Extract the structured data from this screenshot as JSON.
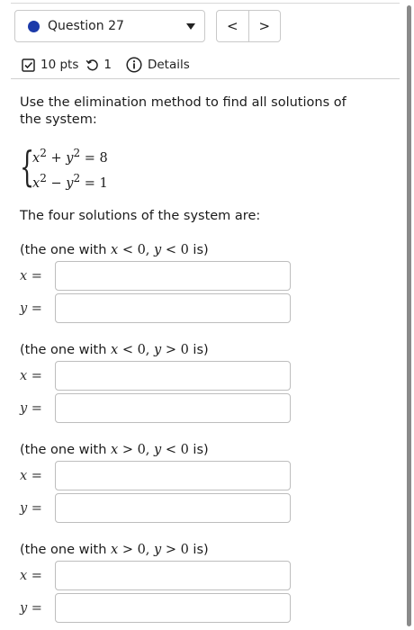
{
  "header": {
    "question_label": "Question 27",
    "nav_prev": "<",
    "nav_next": ">",
    "status_color": "#1c3aa9"
  },
  "meta": {
    "points": "10 pts",
    "attempts": "1",
    "details_label": "Details"
  },
  "question": {
    "prompt": "Use the elimination method to find all solutions of the system:",
    "equations": {
      "eq1": {
        "lhs_a": "x",
        "exp_a": "2",
        "op": " + ",
        "lhs_b": "y",
        "exp_b": "2",
        "rhs": " = 8"
      },
      "eq2": {
        "lhs_a": "x",
        "exp_a": "2",
        "op": " − ",
        "lhs_b": "y",
        "exp_b": "2",
        "rhs": " = 1"
      }
    },
    "four_solutions_text": "The four solutions of the system are:"
  },
  "cases": [
    {
      "label_prefix": "(the one with ",
      "x_var": "x",
      "x_cond": " < 0, ",
      "y_var": "y",
      "y_cond": " < 0",
      "label_suffix": " is)",
      "x_value": "",
      "y_value": ""
    },
    {
      "label_prefix": "(the one with ",
      "x_var": "x",
      "x_cond": " < 0, ",
      "y_var": "y",
      "y_cond": " > 0",
      "label_suffix": " is)",
      "x_value": "",
      "y_value": ""
    },
    {
      "label_prefix": "(the one with ",
      "x_var": "x",
      "x_cond": " > 0, ",
      "y_var": "y",
      "y_cond": " < 0",
      "label_suffix": " is)",
      "x_value": "",
      "y_value": ""
    },
    {
      "label_prefix": "(the one with ",
      "x_var": "x",
      "x_cond": " > 0, ",
      "y_var": "y",
      "y_cond": " > 0",
      "label_suffix": " is)",
      "x_value": "",
      "y_value": ""
    }
  ],
  "var_labels": {
    "x": "x",
    "y": "y",
    "eq": " ="
  }
}
